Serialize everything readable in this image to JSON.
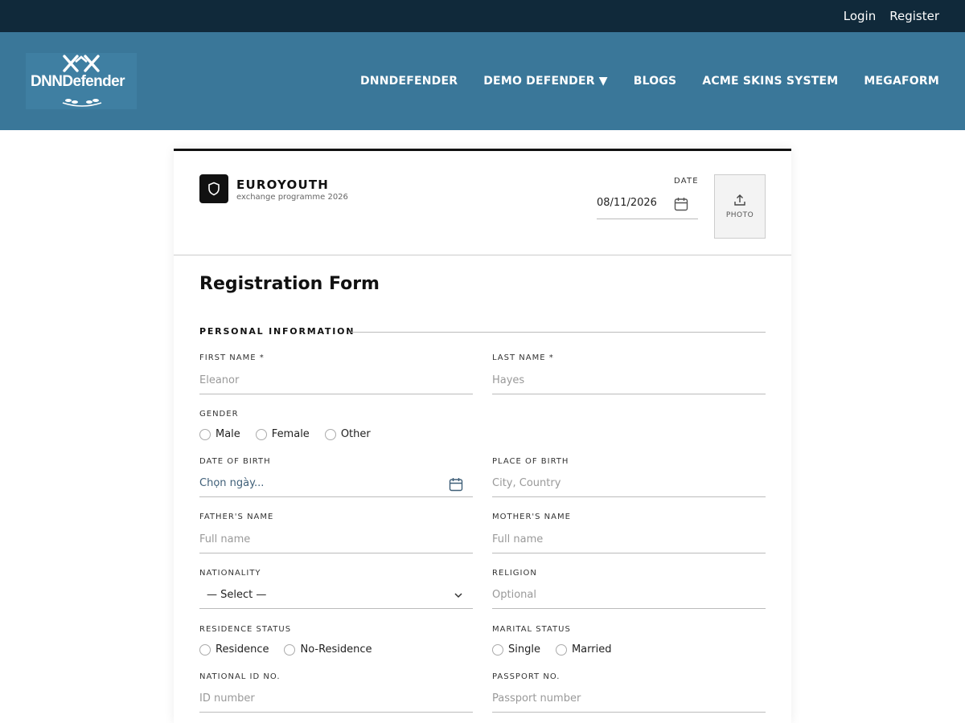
{
  "topbar": {
    "login": "Login",
    "register": "Register"
  },
  "logo": {
    "text": "DNNDefender"
  },
  "nav": {
    "items": [
      "DNNDEFENDER",
      "DEMO DEFENDER ▼",
      "BLOGS",
      "ACME SKINS SYSTEM",
      "MEGAFORM"
    ]
  },
  "header": {
    "brand_name": "EUROYOUTH",
    "brand_sub": "exchange programme 2026",
    "date_label": "DATE",
    "date_value": "08/11/2026",
    "photo_label": "PHOTO"
  },
  "form": {
    "title": "Registration Form",
    "section": "PERSONAL INFORMATION",
    "first_name": {
      "label": "FIRST NAME *",
      "placeholder": "Eleanor"
    },
    "last_name": {
      "label": "LAST NAME *",
      "placeholder": "Hayes"
    },
    "gender": {
      "label": "GENDER",
      "options": [
        "Male",
        "Female",
        "Other"
      ]
    },
    "dob": {
      "label": "DATE OF BIRTH",
      "placeholder": "Chọn ngày..."
    },
    "pob": {
      "label": "PLACE OF BIRTH",
      "placeholder": "City, Country"
    },
    "father": {
      "label": "FATHER'S NAME",
      "placeholder": "Full name"
    },
    "mother": {
      "label": "MOTHER'S NAME",
      "placeholder": "Full name"
    },
    "nationality": {
      "label": "NATIONALITY",
      "value": "— Select —"
    },
    "religion": {
      "label": "RELIGION",
      "placeholder": "Optional"
    },
    "residence": {
      "label": "RESIDENCE STATUS",
      "options": [
        "Residence",
        "No-Residence"
      ]
    },
    "marital": {
      "label": "MARITAL STATUS",
      "options": [
        "Single",
        "Married"
      ]
    },
    "national_id": {
      "label": "NATIONAL ID NO.",
      "placeholder": "ID number"
    },
    "passport": {
      "label": "PASSPORT NO.",
      "placeholder": "Passport number"
    }
  },
  "colors": {
    "topbar": "#10293a",
    "navbar": "#3a7799",
    "accent": "#111111"
  },
  "icons": {
    "calendar": "calendar-icon",
    "upload": "upload-icon",
    "shield": "shield-icon",
    "chevron": "chevron-down-icon"
  }
}
